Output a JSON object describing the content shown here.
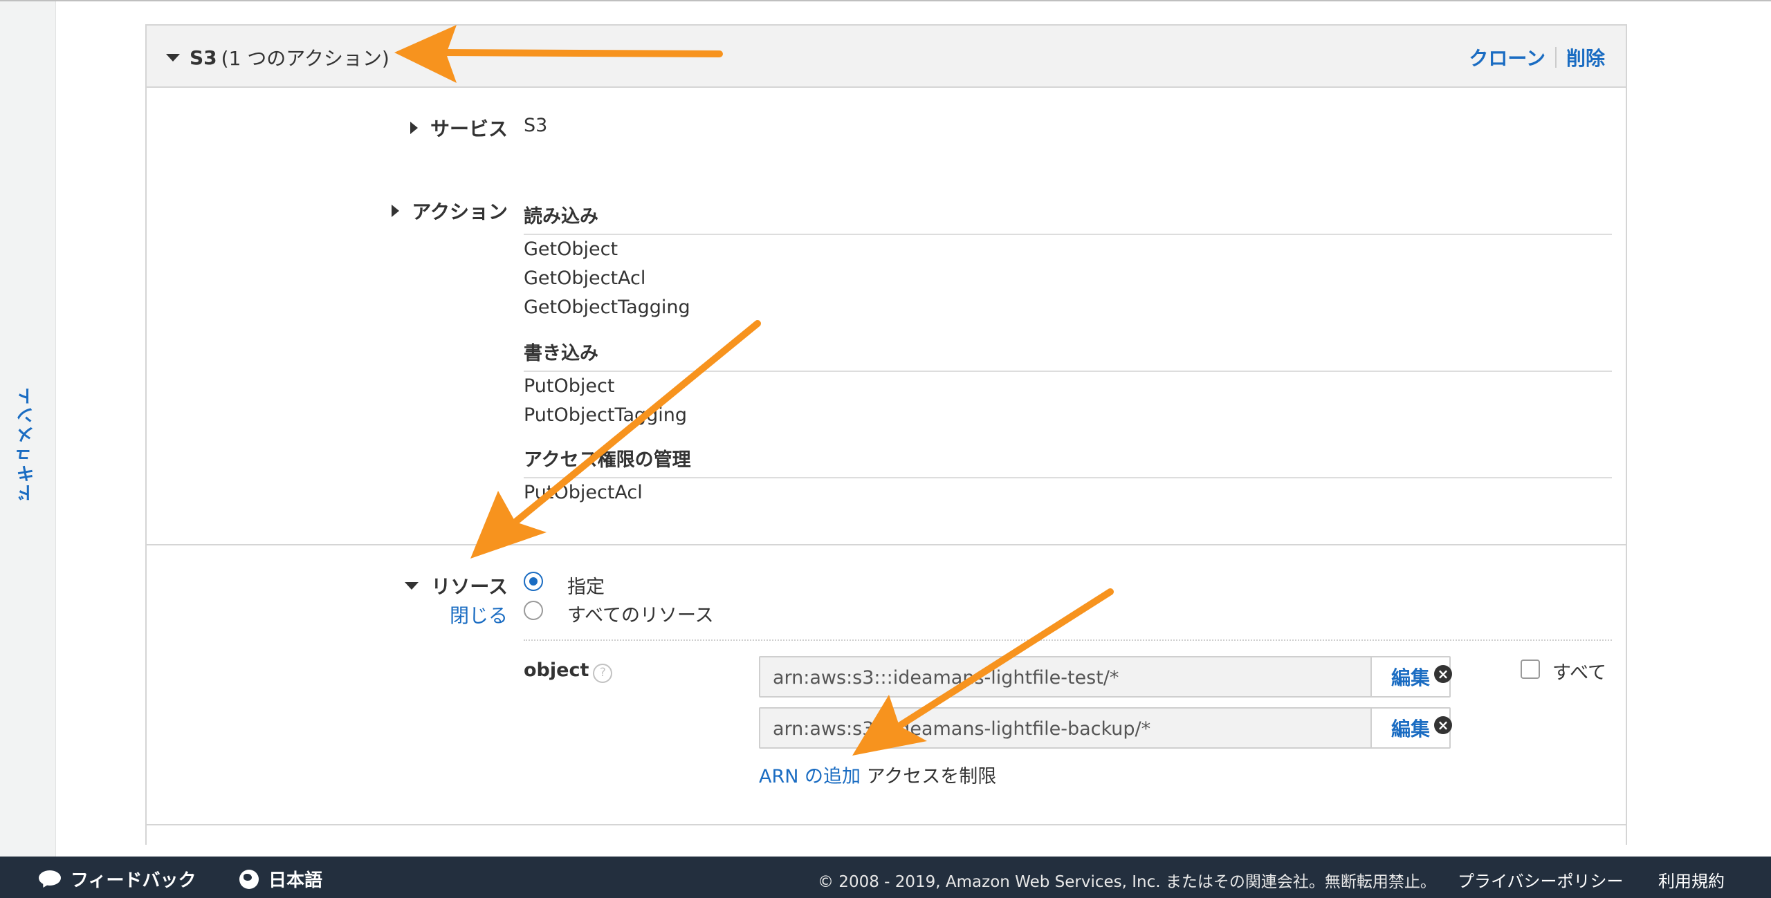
{
  "sidebar": {
    "doc_tab_label": "ドキュメント"
  },
  "panel": {
    "service_name": "S3",
    "action_count_text": "(1 つのアクション)",
    "clone_label": "クローン",
    "delete_label": "削除"
  },
  "service": {
    "label": "サービス",
    "value": "S3"
  },
  "actions": {
    "label": "アクション",
    "groups": [
      {
        "name": "読み込み",
        "items": [
          "GetObject",
          "GetObjectAcl",
          "GetObjectTagging"
        ]
      },
      {
        "name": "書き込み",
        "items": [
          "PutObject",
          "PutObjectTagging"
        ]
      },
      {
        "name": "アクセス権限の管理",
        "items": [
          "PutObjectAcl"
        ]
      }
    ]
  },
  "resources": {
    "label": "リソース",
    "close_label": "閉じる",
    "option_specified": "指定",
    "option_all": "すべてのリソース",
    "selected": "指定",
    "object_label": "object",
    "arns": [
      {
        "value": "arn:aws:s3:::ideamans-lightfile-test/*",
        "edit_label": "編集"
      },
      {
        "value": "arn:aws:s3:::ideamans-lightfile-backup/*",
        "edit_label": "編集"
      }
    ],
    "all_checkbox_label": "すべて",
    "add_arn_label": "ARN の追加",
    "restrict_text": "アクセスを制限"
  },
  "footer": {
    "feedback_label": "フィードバック",
    "language_label": "日本語",
    "copyright": "© 2008 - 2019, Amazon Web Services, Inc. またはその関連会社。無断転用禁止。",
    "privacy_label": "プライバシーポリシー",
    "terms_label": "利用規約"
  },
  "colors": {
    "link": "#1a6cc2",
    "footer_bg": "#232f3e",
    "annotation_arrow": "#f7931e"
  }
}
